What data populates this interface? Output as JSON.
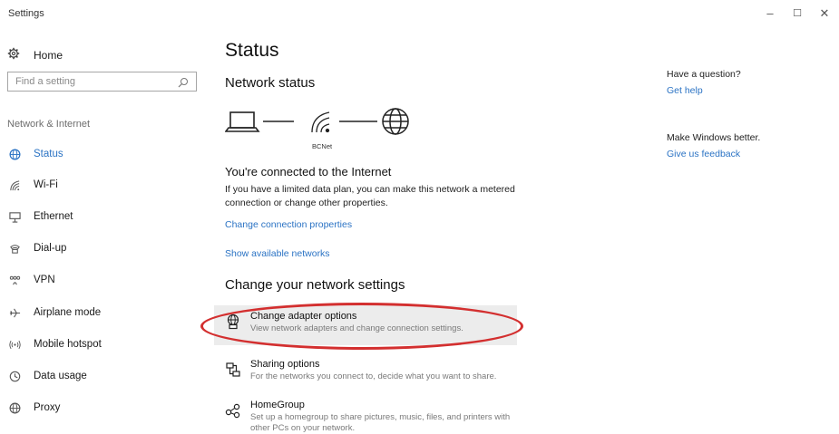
{
  "window": {
    "title": "Settings",
    "minimize": "–",
    "maximize": "☐",
    "close": "✕"
  },
  "sidebar": {
    "home_label": "Home",
    "search_placeholder": "Find a setting",
    "section_label": "Network & Internet",
    "items": [
      {
        "label": "Status",
        "icon": "globe-icon",
        "active": true
      },
      {
        "label": "Wi-Fi",
        "icon": "wifi-icon"
      },
      {
        "label": "Ethernet",
        "icon": "ethernet-icon"
      },
      {
        "label": "Dial-up",
        "icon": "dialup-icon"
      },
      {
        "label": "VPN",
        "icon": "vpn-icon"
      },
      {
        "label": "Airplane mode",
        "icon": "airplane-icon"
      },
      {
        "label": "Mobile hotspot",
        "icon": "hotspot-icon"
      },
      {
        "label": "Data usage",
        "icon": "data-usage-icon"
      },
      {
        "label": "Proxy",
        "icon": "globe-icon"
      }
    ]
  },
  "main": {
    "title": "Status",
    "network_status_heading": "Network status",
    "network_name": "BCNet",
    "connected_title": "You're connected to the Internet",
    "connected_desc": "If you have a limited data plan, you can make this network a metered connection or change other properties.",
    "change_connection_link": "Change connection properties",
    "show_networks_link": "Show available networks",
    "change_settings_heading": "Change your network settings",
    "options": [
      {
        "title": "Change adapter options",
        "desc": "View network adapters and change connection settings."
      },
      {
        "title": "Sharing options",
        "desc": "For the networks you connect to, decide what you want to share."
      },
      {
        "title": "HomeGroup",
        "desc": "Set up a homegroup to share pictures, music, files, and printers with other PCs on your network."
      }
    ]
  },
  "right_panel": {
    "question": "Have a question?",
    "get_help": "Get help",
    "make_better": "Make Windows better.",
    "feedback": "Give us feedback"
  },
  "colors": {
    "accent": "#2b73c4",
    "highlight_ring": "#d32f2f",
    "hover_bg": "#ececec"
  }
}
